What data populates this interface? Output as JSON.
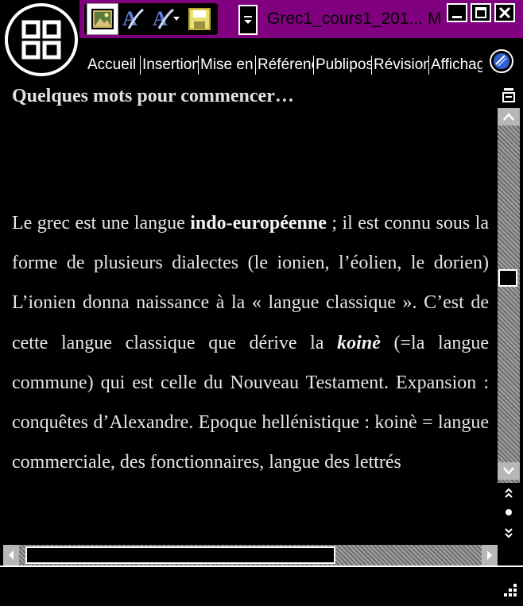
{
  "window": {
    "title": "Grec1_cours1_201... M",
    "minimize_icon": "minimize-icon",
    "maximize_icon": "maximize-icon",
    "close_icon": "close-icon"
  },
  "quick_access": {
    "buttons": [
      {
        "icon": "picture-icon"
      },
      {
        "icon": "spelling-icon"
      },
      {
        "icon": "spelling-dropdown-icon"
      },
      {
        "icon": "save-icon"
      }
    ],
    "more_icon": "customize-toolbar-icon"
  },
  "ribbon": {
    "tabs": [
      "Accueil",
      "Insertion",
      "Mise en page",
      "Références",
      "Publipostage",
      "Révision",
      "Affichage"
    ],
    "help_icon": "help-icon"
  },
  "document": {
    "heading": "Quelques mots pour commencer…",
    "paragraph": {
      "t1": "Le grec est une langue ",
      "b1": "indo-européenne",
      "t2": " ; il est connu sous la forme de plusieurs dialectes (le ionien, l’éolien, le dorien) L’ionien donna naissance à la « langue classique ». C’est de cette langue classique que dérive la ",
      "b2": "koinè",
      "t3": " (=la langue commune) qui est celle du Nouveau Testament. Expansion : conquêtes d’Alexandre. Epoque hellénistique : koinè = langue commerciale, des fonctionnaires, langue des lettrés"
    }
  },
  "scrollbars": {
    "vertical_position": 0.45,
    "horizontal_position": 0.0
  },
  "colors": {
    "title_band": "#800080",
    "background": "#000000",
    "text": "#e6e6e6",
    "scroll_track": "#8c8c8c"
  }
}
